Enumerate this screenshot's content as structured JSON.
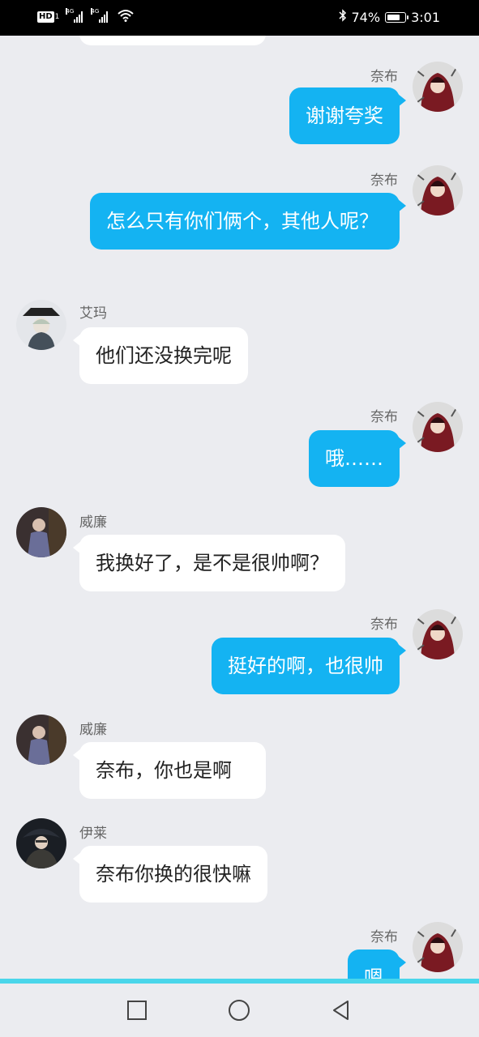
{
  "status_bar": {
    "network_badge": "HD",
    "network_badge_sub": "1",
    "signal1_label": "4G",
    "signal2_label": "4G",
    "battery_percent": "74%",
    "battery_level": 0.74,
    "time": "3:01"
  },
  "messages": [
    {
      "side": "out",
      "sender": "奈布",
      "text": "谢谢夸奖"
    },
    {
      "side": "out",
      "sender": "奈布",
      "text": "怎么只有你们俩个，其他人呢？"
    },
    {
      "side": "in",
      "sender": "艾玛",
      "text": "他们还没换完呢"
    },
    {
      "side": "out",
      "sender": "奈布",
      "text": "哦……"
    },
    {
      "side": "in",
      "sender": "威廉",
      "text": "我换好了，是不是很帅啊？"
    },
    {
      "side": "out",
      "sender": "奈布",
      "text": "挺好的啊，也很帅"
    },
    {
      "side": "in",
      "sender": "威廉",
      "text": "奈布，你也是啊"
    },
    {
      "side": "in",
      "sender": "伊莱",
      "text": "奈布你换的很快嘛"
    },
    {
      "side": "out",
      "sender": "奈布",
      "text": "嗯"
    }
  ],
  "nav": {
    "recent": "square-icon",
    "home": "circle-icon",
    "back": "triangle-back-icon"
  }
}
